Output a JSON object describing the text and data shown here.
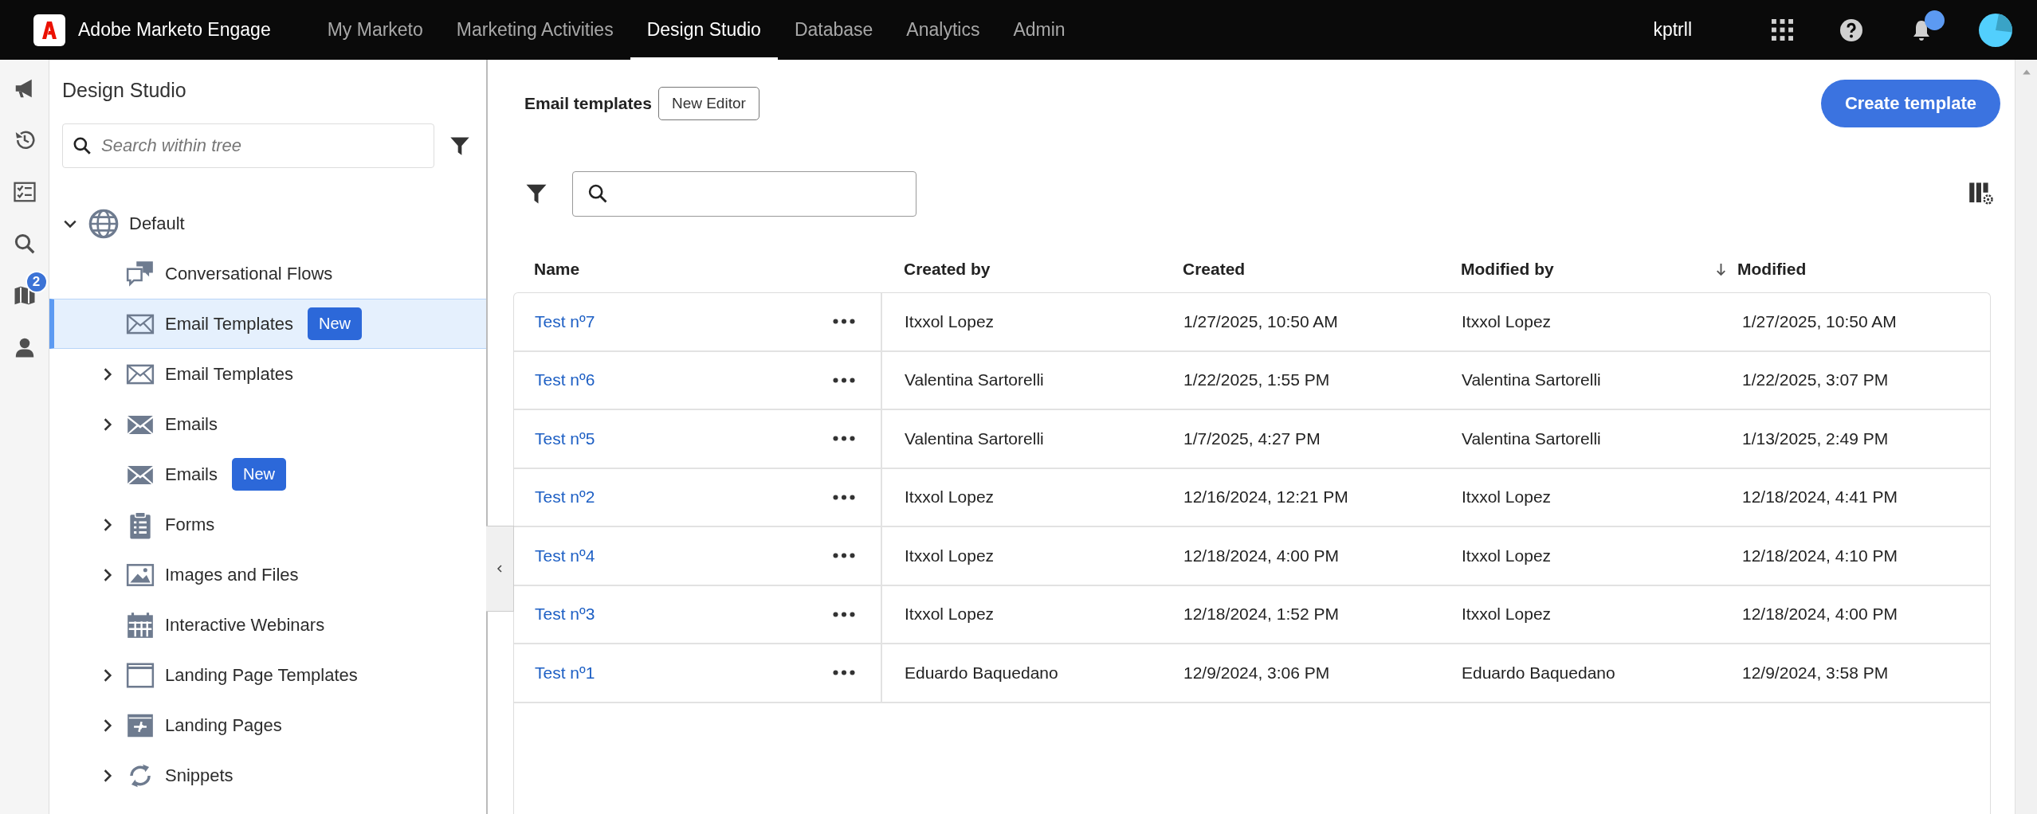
{
  "top_bar": {
    "product": "Adobe Marketo Engage",
    "tabs": [
      {
        "label": "My Marketo",
        "selected": false
      },
      {
        "label": "Marketing Activities",
        "selected": false
      },
      {
        "label": "Design Studio",
        "selected": true
      },
      {
        "label": "Database",
        "selected": false
      },
      {
        "label": "Analytics",
        "selected": false
      },
      {
        "label": "Admin",
        "selected": false
      }
    ],
    "user": "kptrll",
    "notification_dot": true
  },
  "rail": [
    {
      "kind": "megaphone"
    },
    {
      "kind": "history"
    },
    {
      "kind": "checklist"
    },
    {
      "kind": "search"
    },
    {
      "kind": "map",
      "badge": "2"
    },
    {
      "kind": "person"
    }
  ],
  "tree_panel": {
    "title": "Design Studio",
    "search": {
      "placeholder": "Search within tree"
    },
    "tree": [
      {
        "label": "Default",
        "kind": "globe",
        "expandable": true,
        "expanded": true,
        "selected": false,
        "children": [
          {
            "label": "Conversational Flows",
            "kind": "chat",
            "expandable": false,
            "selected": false
          },
          {
            "label": "Email Templates",
            "kind": "envelope-outline",
            "expandable": false,
            "selected": true,
            "badge": "New"
          },
          {
            "label": "Email Templates",
            "kind": "envelope-outline",
            "expandable": true,
            "expanded": false,
            "selected": false
          },
          {
            "label": "Emails",
            "kind": "envelope",
            "expandable": true,
            "expanded": false,
            "selected": false
          },
          {
            "label": "Emails",
            "kind": "envelope",
            "expandable": false,
            "selected": false,
            "badge": "New"
          },
          {
            "label": "Forms",
            "kind": "form",
            "expandable": true,
            "expanded": false,
            "selected": false
          },
          {
            "label": "Images and Files",
            "kind": "image",
            "expandable": true,
            "expanded": false,
            "selected": false
          },
          {
            "label": "Interactive Webinars",
            "kind": "calendar",
            "expandable": false,
            "selected": false
          },
          {
            "label": "Landing Page Templates",
            "kind": "page",
            "expandable": true,
            "expanded": false,
            "selected": false
          },
          {
            "label": "Landing Pages",
            "kind": "landing",
            "expandable": true,
            "expanded": false,
            "selected": false
          },
          {
            "label": "Snippets",
            "kind": "snippet",
            "expandable": true,
            "expanded": false,
            "selected": false
          }
        ]
      }
    ]
  },
  "main": {
    "title": "Email templates",
    "editor_button": "New Editor",
    "create_button": "Create template",
    "table": {
      "columns": [
        {
          "label": "Name",
          "sorted": false
        },
        {
          "label": "Created by",
          "sorted": false
        },
        {
          "label": "Created",
          "sorted": false
        },
        {
          "label": "Modified by",
          "sorted": false
        },
        {
          "label": "Modified",
          "sorted": true
        }
      ],
      "rows": [
        {
          "name": "Test nº7",
          "created_by": "Itxxol Lopez",
          "created": "1/27/2025, 10:50 AM",
          "modified_by": "Itxxol Lopez",
          "modified": "1/27/2025, 10:50 AM"
        },
        {
          "name": "Test nº6",
          "created_by": "Valentina Sartorelli",
          "created": "1/22/2025, 1:55 PM",
          "modified_by": "Valentina Sartorelli",
          "modified": "1/22/2025, 3:07 PM"
        },
        {
          "name": "Test nº5",
          "created_by": "Valentina Sartorelli",
          "created": "1/7/2025, 4:27 PM",
          "modified_by": "Valentina Sartorelli",
          "modified": "1/13/2025, 2:49 PM"
        },
        {
          "name": "Test nº2",
          "created_by": "Itxxol Lopez",
          "created": "12/16/2024, 12:21 PM",
          "modified_by": "Itxxol Lopez",
          "modified": "12/18/2024, 4:41 PM"
        },
        {
          "name": "Test nº4",
          "created_by": "Itxxol Lopez",
          "created": "12/18/2024, 4:00 PM",
          "modified_by": "Itxxol Lopez",
          "modified": "12/18/2024, 4:10 PM"
        },
        {
          "name": "Test nº3",
          "created_by": "Itxxol Lopez",
          "created": "12/18/2024, 1:52 PM",
          "modified_by": "Itxxol Lopez",
          "modified": "12/18/2024, 4:00 PM"
        },
        {
          "name": "Test nº1",
          "created_by": "Eduardo Baquedano",
          "created": "12/9/2024, 3:06 PM",
          "modified_by": "Eduardo Baquedano",
          "modified": "12/9/2024, 3:58 PM"
        }
      ]
    }
  }
}
